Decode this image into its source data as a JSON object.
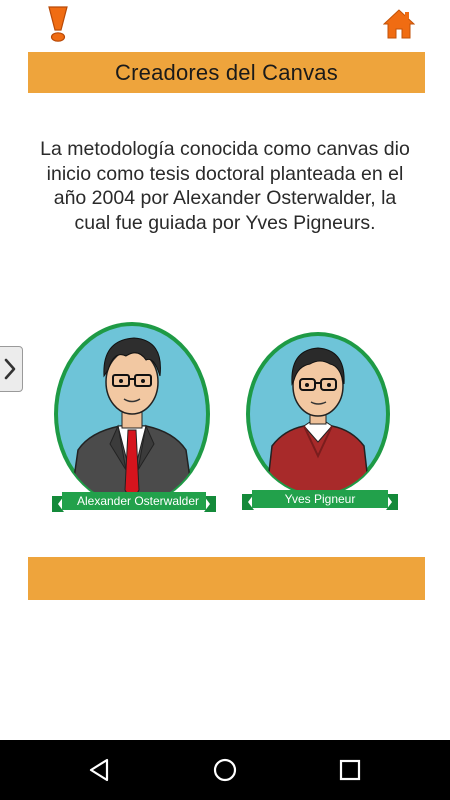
{
  "header": {
    "alert_icon": "exclamation-icon",
    "home_icon": "home-icon",
    "accent_color": "#eea43c",
    "icon_color": "#f06c12"
  },
  "title": "Creadores del Canvas",
  "description": "La metodología conocida como canvas dio inicio como tesis doctoral planteada en el año 2004 por Alexander Osterwalder, la cual fue guiada por Yves Pigneurs.",
  "side_nav": {
    "icon": "chevron-right-icon"
  },
  "creators": [
    {
      "name": "Alexander Osterwalder"
    },
    {
      "name": "Yves Pigneur"
    }
  ],
  "system_nav": {
    "back_icon": "back-triangle-icon",
    "home_icon": "home-circle-icon",
    "recents_icon": "recents-square-icon"
  }
}
